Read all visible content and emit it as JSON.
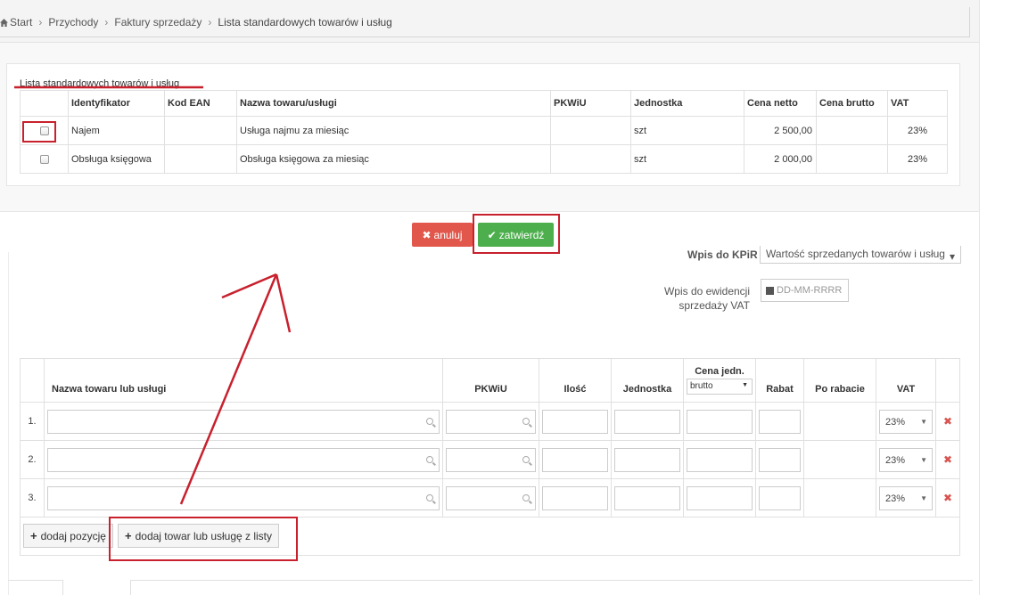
{
  "breadcrumb": {
    "items": [
      "Start",
      "Przychody",
      "Faktury sprzedaży"
    ],
    "current": "Lista standardowych towarów i usług"
  },
  "modal": {
    "title": "Lista standardowych towarów i usług",
    "columns": [
      "Identyfikator",
      "Kod EAN",
      "Nazwa towaru/usługi",
      "PKWiU",
      "Jednostka",
      "Cena netto",
      "Cena brutto",
      "VAT"
    ],
    "rows": [
      {
        "id": "Najem",
        "ean": "",
        "name": "Usługa najmu za miesiąc",
        "pkwiu": "",
        "unit": "szt",
        "net": "2 500,00",
        "gross": "",
        "vat": "23%"
      },
      {
        "id": "Obsługa księgowa",
        "ean": "",
        "name": "Obsługa księgowa za miesiąc",
        "pkwiu": "",
        "unit": "szt",
        "net": "2 000,00",
        "gross": "",
        "vat": "23%"
      }
    ],
    "cancel_label": "anuluj",
    "confirm_label": "zatwierdź"
  },
  "form": {
    "kpir_label": "Wpis do KPiR",
    "kpir_value": "Wartość sprzedanych towarów i usług",
    "vat_register_label": "Wpis do ewidencji sprzedaży VAT",
    "date_placeholder": "DD-MM-RRRR"
  },
  "items": {
    "headers": {
      "name": "Nazwa towaru lub usługi",
      "pkwiu": "PKWiU",
      "qty": "Ilość",
      "unit": "Jednostka",
      "price": "Cena jedn.",
      "price_mode": "brutto",
      "discount": "Rabat",
      "after_discount": "Po rabacie",
      "vat": "VAT"
    },
    "rows": [
      {
        "num": "1.",
        "vat": "23%"
      },
      {
        "num": "2.",
        "vat": "23%"
      },
      {
        "num": "3.",
        "vat": "23%"
      }
    ],
    "add_position_label": "dodaj pozycję",
    "add_from_list_label": "dodaj towar lub usługę z listy"
  },
  "colors": {
    "cancel": "#e2574c",
    "confirm": "#4cae4c",
    "delete": "#d9534f",
    "annotation": "#c8202d"
  }
}
